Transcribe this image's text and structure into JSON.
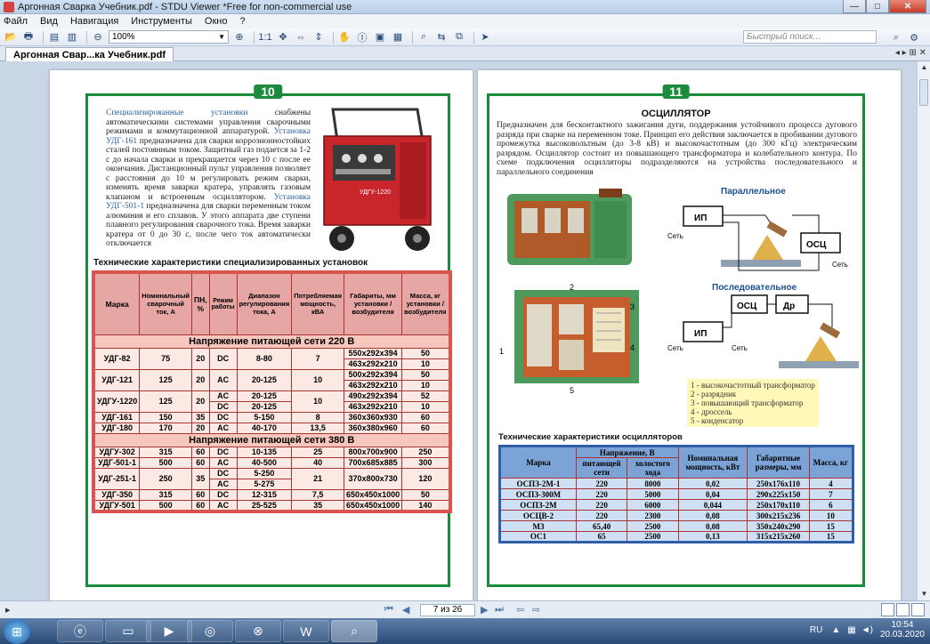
{
  "window": {
    "title": "Аргонная Сварка Учебник.pdf - STDU Viewer *Free for non-commercial use",
    "controls": [
      "—",
      "□",
      "✕"
    ]
  },
  "menu": [
    "Файл",
    "Вид",
    "Навигация",
    "Инструменты",
    "Окно",
    "?"
  ],
  "toolbar": {
    "zoom": "100%",
    "fit_label": "1:1",
    "search_placeholder": "Быстрый поиск..."
  },
  "tab": {
    "label": "Аргонная Свар...ка Учебник.pdf",
    "nav": "◂ ▸ ⊞ ✕"
  },
  "left_page": {
    "number": "10",
    "intro": {
      "p1_lead": "Специализированные установки",
      "p1_rest": " снабжены автоматическими системами управления сварочными режимами и коммутационной аппаратурой. ",
      "p2_lead": "Установка УДГ-161",
      "p2_rest": " предназначена для сварки коррозионностойких сталей постоянным током. Защитный газ подается за 1-2 с до начала сварки и прекращается через 10 с после ее окончания. Дистанционный пульт управления позволяет с расстояния до 10 м регулировать режим сварки, изменять время заварки кратера, управлять газовым клапаном и встроенным осциллятором. ",
      "p3_lead": "Установка УДГ-501-1",
      "p3_rest": " предназначена для сварки переменным током алюминия и его сплавов. У этого аппарата две ступени плавного регулирования сварочного тока. Время заварки кратера от 0 до 30 с, после чего ток автоматически отключается"
    },
    "table_title": "Технические характеристики специализированных установок",
    "table_headers": [
      "Марка",
      "Номинальный сварочный ток, А",
      "ПН, %",
      "Режим работы",
      "Диапазон регулирования тока, А",
      "Потребляемая мощность, кВА",
      "Габариты, мм установки / возбудителя",
      "Масса, кг установки / возбудителя"
    ],
    "group1": "Напряжение питающей сети 220 В",
    "group2": "Напряжение питающей сети 380 В",
    "rows_g1": [
      {
        "mark": "УДГ-82",
        "cur": "75",
        "pn": "20",
        "mode": "DC",
        "range": "8-80",
        "power": "7",
        "dim1": "550x292x394",
        "dim2": "463x292x210",
        "m1": "50",
        "m2": "10"
      },
      {
        "mark": "УДГ-121",
        "cur": "125",
        "pn": "20",
        "mode": "AC",
        "range": "20-125",
        "power": "10",
        "dim1": "500x292x394",
        "dim2": "463x292x210",
        "m1": "50",
        "m2": "10"
      },
      {
        "mark": "УДГУ-1220",
        "cur": "125",
        "pn": "20",
        "mode": "AC",
        "mode2": "DC",
        "range": "20-125",
        "range2": "20-125",
        "power": "10",
        "dim1": "490x292x394",
        "dim2": "463x292x210",
        "m1": "52",
        "m2": "10"
      },
      {
        "mark": "УДГ-161",
        "cur": "150",
        "pn": "35",
        "mode": "DC",
        "range": "5-150",
        "power": "8",
        "dim1": "360x360x930",
        "m1": "60"
      },
      {
        "mark": "УДГ-180",
        "cur": "170",
        "pn": "20",
        "mode": "AC",
        "range": "40-170",
        "power": "13,5",
        "dim1": "360x380x960",
        "m1": "60"
      }
    ],
    "rows_g2": [
      {
        "mark": "УДГУ-302",
        "cur": "315",
        "pn": "60",
        "mode": "DC",
        "range": "10-135",
        "power": "25",
        "dim1": "800x700x900",
        "m1": "250"
      },
      {
        "mark": "УДГ-501-1",
        "cur": "500",
        "pn": "60",
        "mode": "AC",
        "range": "40-500",
        "power": "40",
        "dim1": "700x685x885",
        "m1": "300"
      },
      {
        "mark": "УДГ-251-1",
        "cur": "250",
        "pn": "35",
        "mode": "DC",
        "mode2": "AC",
        "range": "5-250",
        "range2": "5-275",
        "power": "21",
        "dim1": "370x800x730",
        "m1": "120"
      },
      {
        "mark": "УДГ-350",
        "cur": "315",
        "pn": "60",
        "mode": "DC",
        "range": "12-315",
        "power": "7,5",
        "dim1": "650x450x1000",
        "m1": "50"
      },
      {
        "mark": "УДГУ-501",
        "cur": "500",
        "pn": "60",
        "mode": "AC",
        "range": "25-525",
        "power": "35",
        "dim1": "650x450x1000",
        "m1": "140"
      }
    ],
    "welder_label": "УДГУ-1220"
  },
  "right_page": {
    "number": "11",
    "title": "ОСЦИЛЛЯТОР",
    "text": "Предназначен для бесконтактного зажигания дуги, поддержания устойчивого процесса дугового разряда при сварке на переменном токе. Принцип его действия заключается в пробивании дугового промежутка высоковольтным (до 3-8 кВ) и высокочастотным (до 300 кГц) электрическим разрядом. Осциллятор состоит из повышающего трансформатора и колебательного контура. По схеме подключения осцилляторы подразделяются на устройства последовательного и параллельного соединения",
    "diagram_parallel": "Параллельное",
    "diagram_series": "Последовательное",
    "ip": "ИП",
    "osc": "ОСЦ",
    "dr": "Др",
    "net": "Сеть",
    "callouts": [
      "1",
      "2",
      "3",
      "4",
      "5"
    ],
    "legend": [
      "1 - высокочастотный трансформатор",
      "2 - разрядник",
      "3 - повышающий трансформатор",
      "4 - дроссель",
      "5 - конденсатор"
    ],
    "table_title": "Технические характеристики осцилляторов",
    "headers": {
      "mark": "Марка",
      "voltage": "Напряжение, В",
      "supply": "питающей сети",
      "idle": "холостого хода",
      "power": "Номинальная мощность, кВт",
      "dims": "Габаритные размеры, мм",
      "mass": "Масса, кг"
    },
    "rows": [
      {
        "mark": "ОСПЗ-2М-1",
        "supply": "220",
        "idle": "8000",
        "power": "0,02",
        "dims": "250x176x110",
        "mass": "4"
      },
      {
        "mark": "ОСПЗ-300М",
        "supply": "220",
        "idle": "5000",
        "power": "0,04",
        "dims": "290x225x150",
        "mass": "7"
      },
      {
        "mark": "ОСПЗ-2М",
        "supply": "220",
        "idle": "6000",
        "power": "0,044",
        "dims": "250x170x110",
        "mass": "6"
      },
      {
        "mark": "ОСЦВ-2",
        "supply": "220",
        "idle": "2300",
        "power": "0,08",
        "dims": "300x215x236",
        "mass": "10"
      },
      {
        "mark": "М3",
        "supply": "65,40",
        "idle": "2500",
        "power": "0,08",
        "dims": "350x240x290",
        "mass": "15"
      },
      {
        "mark": "ОС1",
        "supply": "65",
        "idle": "2500",
        "power": "0,13",
        "dims": "315x215x260",
        "mass": "15"
      }
    ]
  },
  "statusbar": {
    "page_indicator": "7 из 26"
  },
  "taskbar": {
    "lang": "RU",
    "time": "10:54",
    "date": "20.03.2020"
  }
}
